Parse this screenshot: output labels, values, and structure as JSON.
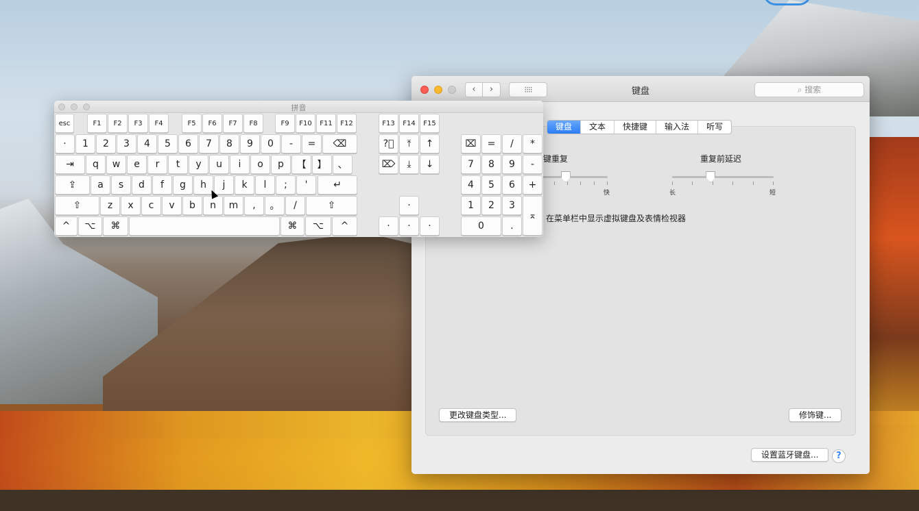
{
  "prefs": {
    "title": "键盘",
    "search_placeholder": "搜索",
    "tabs": [
      "键盘",
      "文本",
      "快捷键",
      "输入法",
      "听写"
    ],
    "active_tab": 0,
    "key_repeat_label": "按键重复",
    "key_repeat_fast": "快",
    "delay_label": "重复前延迟",
    "delay_long": "长",
    "delay_short": "短",
    "show_viewer_label": "在菜单栏中显示虚拟键盘及表情检视器",
    "change_type_button": "更改键盘类型...",
    "modifier_button": "修饰键...",
    "bluetooth_button": "设置蓝牙键盘...",
    "help": "?",
    "key_repeat_level": 0.55,
    "delay_level": 0.38
  },
  "keyboard_viewer": {
    "title": "拼音",
    "keys": {
      "esc": "esc",
      "f": [
        "F1",
        "F2",
        "F3",
        "F4",
        "F5",
        "F6",
        "F7",
        "F8",
        "F9",
        "F10",
        "F11",
        "F12",
        "F13",
        "F14",
        "F15"
      ],
      "row1": [
        "·",
        "1",
        "2",
        "3",
        "4",
        "5",
        "6",
        "7",
        "8",
        "9",
        "0",
        "-",
        "=",
        "⌫"
      ],
      "row2": [
        "⇥",
        "q",
        "w",
        "e",
        "r",
        "t",
        "y",
        "u",
        "i",
        "o",
        "p",
        "【",
        "】",
        "、"
      ],
      "row3": [
        "⇪",
        "a",
        "s",
        "d",
        "f",
        "g",
        "h",
        "j",
        "k",
        "l",
        ";",
        "'",
        "↵"
      ],
      "row4": [
        "⇧",
        "z",
        "x",
        "c",
        "v",
        "b",
        "n",
        "m",
        ",",
        "。",
        "/",
        "⇧"
      ],
      "row5": [
        "^",
        "⌥",
        "⌘",
        "⌘",
        "⌥",
        "^"
      ],
      "nav": [
        "?⃝",
        "⤒",
        "↑",
        "⌦",
        "⤓",
        "↓"
      ],
      "arrows": [
        "·",
        "·",
        "·",
        "·"
      ],
      "numpad": [
        "⌧",
        "=",
        "/",
        "*",
        "7",
        "8",
        "9",
        "-",
        "4",
        "5",
        "6",
        "+",
        "1",
        "2",
        "3",
        "⌅",
        "0",
        "."
      ]
    }
  }
}
